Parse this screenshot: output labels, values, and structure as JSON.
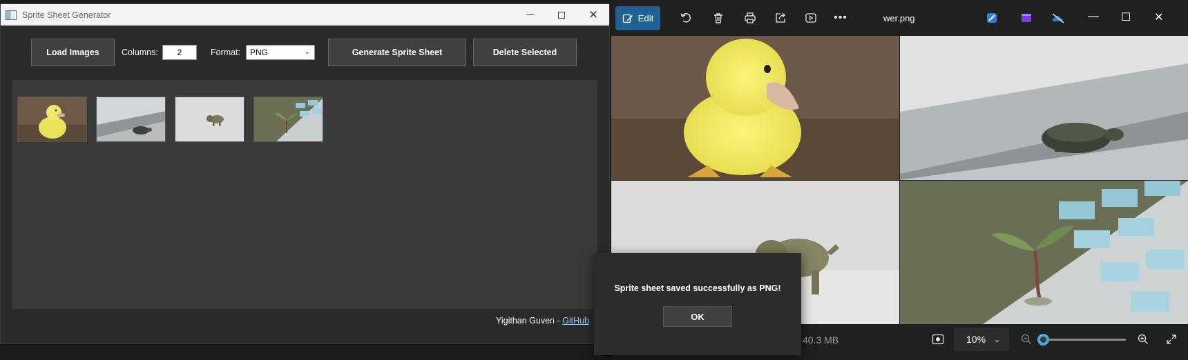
{
  "ssg": {
    "title": "Sprite Sheet Generator",
    "load_label": "Load Images",
    "columns_label": "Columns:",
    "columns_value": "2",
    "format_label": "Format:",
    "format_value": "PNG",
    "generate_label": "Generate Sprite Sheet",
    "delete_label": "Delete Selected",
    "credit_prefix": "Yigithan Guven - ",
    "credit_link": "GitHub"
  },
  "viewer": {
    "edit_label": "Edit",
    "file_name": "wer.png",
    "size_text": "40.3 MB",
    "zoom_value": "10%",
    "zoom_percent": 10
  },
  "dialog": {
    "message": "Sprite sheet saved successfully as PNG!",
    "ok_label": "OK"
  },
  "icons": {
    "accent": "#1f6293",
    "slider_accent": "#4ea8e0"
  }
}
